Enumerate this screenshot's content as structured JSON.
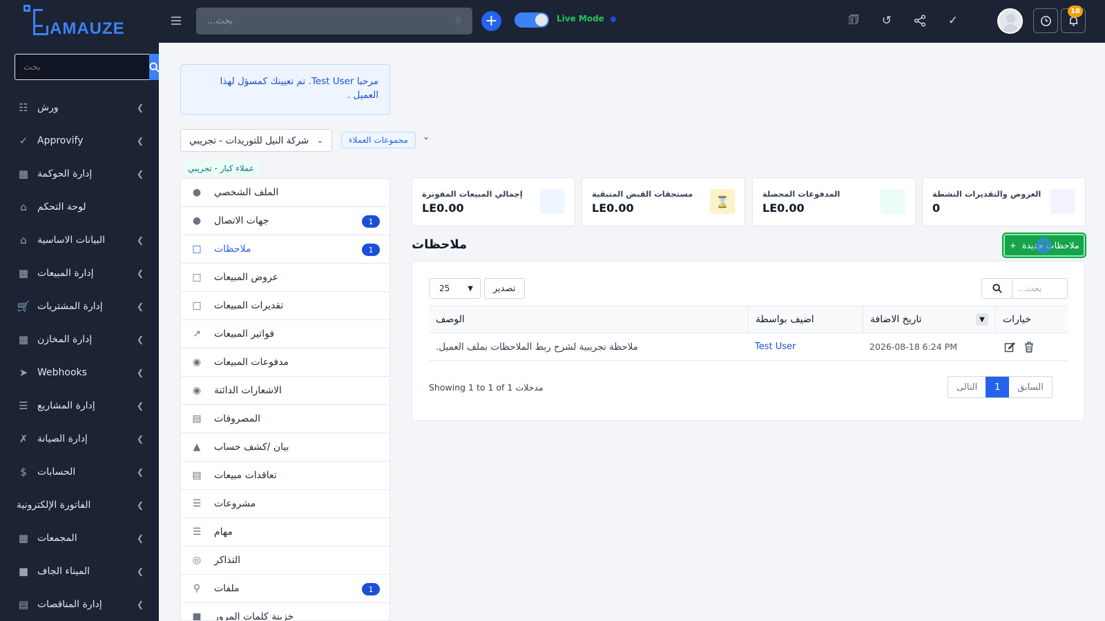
{
  "brand": {
    "name": "AMAUZE"
  },
  "sidebar": {
    "search_placeholder": "بحث",
    "items": [
      {
        "label": "ورش",
        "icon": "users-group-icon",
        "has_children": true
      },
      {
        "label": "Approvify",
        "icon": "check-icon",
        "has_children": true
      },
      {
        "label": "إدارة الحوكمة",
        "icon": "sitemap-icon",
        "has_children": true
      },
      {
        "label": "لوحة التحكم",
        "icon": "home-icon",
        "has_children": false
      },
      {
        "label": "البيانات الاساسية",
        "icon": "bank-icon",
        "has_children": true
      },
      {
        "label": "إدارة المبيعات",
        "icon": "cash-register-icon",
        "has_children": true
      },
      {
        "label": "إدارة المشتريات",
        "icon": "cart-icon",
        "has_children": true
      },
      {
        "label": "إدارة المخازن",
        "icon": "warehouse-icon",
        "has_children": true
      },
      {
        "label": "Webhooks",
        "icon": "send-icon",
        "has_children": true
      },
      {
        "label": "إدارة المشاريع",
        "icon": "gantt-icon",
        "has_children": true
      },
      {
        "label": "إدارة الصيانة",
        "icon": "tools-icon",
        "has_children": true
      },
      {
        "label": "الحسابات",
        "icon": "dollar-icon",
        "has_children": true
      },
      {
        "label": "الفاتورة الإلكترونية",
        "icon": "",
        "has_children": true
      },
      {
        "label": "المجمعات",
        "icon": "buildings-icon",
        "has_children": true
      },
      {
        "label": "الميناء الجاف",
        "icon": "truck-icon",
        "has_children": true
      },
      {
        "label": "إدارة المناقصات",
        "icon": "document-icon",
        "has_children": true
      }
    ]
  },
  "topbar": {
    "search_placeholder": "بحث...",
    "live_mode_label": "Live Mode",
    "notification_count": "18"
  },
  "alert": {
    "text": "مرحبا Test User. تم تعيينك كمسؤل لهذا العميل ."
  },
  "customer": {
    "selected": "شركة النيل للتوريدات - تجريبي",
    "groups_label": "مجموعات العملاء",
    "tier": "عملاء كبار - تجريبي"
  },
  "profile_menu": [
    {
      "label": "الملف الشخصي",
      "icon": "user-circle-icon",
      "badge": ""
    },
    {
      "label": "جهات الاتصال",
      "icon": "user-icon",
      "badge": "1"
    },
    {
      "label": "ملاحظات",
      "icon": "note-icon",
      "badge": "1",
      "active": true
    },
    {
      "label": "عروض المبيعات",
      "icon": "file-icon",
      "badge": ""
    },
    {
      "label": "تقديرات المبيعات",
      "icon": "file-icon",
      "badge": ""
    },
    {
      "label": "فواتير المبيعات",
      "icon": "chart-line-icon",
      "badge": ""
    },
    {
      "label": "مدفوعات المبيعات",
      "icon": "money-bag-icon",
      "badge": ""
    },
    {
      "label": "الاشعارات الدائنة",
      "icon": "money-bag-icon",
      "badge": ""
    },
    {
      "label": "المصروفات",
      "icon": "file-text-icon",
      "badge": ""
    },
    {
      "label": "بيان /كشف حساب",
      "icon": "area-chart-icon",
      "badge": ""
    },
    {
      "label": "تعاقدات مبيعات",
      "icon": "contract-icon",
      "badge": ""
    },
    {
      "label": "مشروعات",
      "icon": "gantt-icon",
      "badge": ""
    },
    {
      "label": "مهام",
      "icon": "tasks-icon",
      "badge": ""
    },
    {
      "label": "التذاكر",
      "icon": "lifebuoy-icon",
      "badge": ""
    },
    {
      "label": "ملفات",
      "icon": "paperclip-icon",
      "badge": "1"
    },
    {
      "label": "خزينة كلمات المرور",
      "icon": "lock-icon",
      "badge": ""
    }
  ],
  "stats": [
    {
      "label": "إجمالي المبيعات المفوترة",
      "value": "LE0.00",
      "color": "#eff6ff"
    },
    {
      "label": "مستحقات القبض المتبقية",
      "value": "LE0.00",
      "color": "#fef3c7"
    },
    {
      "label": "المدفوعات المحصلة",
      "value": "LE0.00",
      "color": "#ecfdf5"
    },
    {
      "label": "العروض والتقديرات النشطة",
      "value": "0",
      "color": "#f5f3ff"
    }
  ],
  "notes": {
    "title": "ملاحظات",
    "new_button": "ملاحظات جديدة",
    "page_size": "25",
    "export_label": "تصدير",
    "search_placeholder": "بحث...",
    "columns": {
      "description": "الوصف",
      "added_by": "اضيف بواسطة",
      "date_added": "تاريخ الاضافة",
      "options": "خيارات"
    },
    "rows": [
      {
        "description": "ملاحظة تجريبية لشرح ربط الملاحظات بملف العميل.",
        "added_by": "Test User",
        "date_added": "2026-08-18 6:24 PM"
      }
    ],
    "showing": "Showing 1 to 1 of 1 مدخلات",
    "pager": {
      "next": "التالى",
      "current": "1",
      "prev": "السابق"
    }
  }
}
